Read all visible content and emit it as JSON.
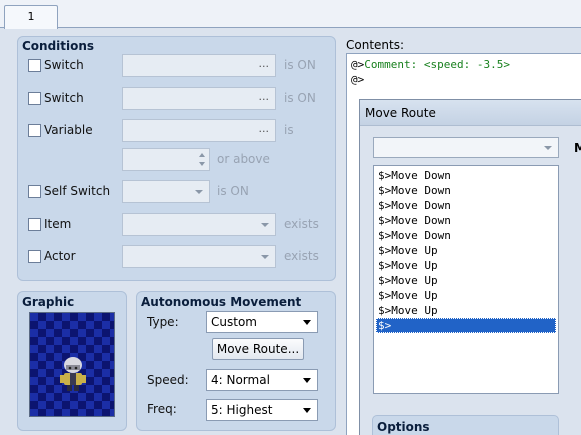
{
  "tab": {
    "label": "1"
  },
  "conditions": {
    "title": "Conditions",
    "rows": [
      {
        "label": "Switch",
        "suffix": "is ON"
      },
      {
        "label": "Switch",
        "suffix": "is ON"
      },
      {
        "label": "Variable",
        "suffix": "is"
      },
      {
        "label": "",
        "suffix": "or above"
      },
      {
        "label": "Self Switch",
        "suffix": "is ON"
      },
      {
        "label": "Item",
        "suffix": "exists"
      },
      {
        "label": "Actor",
        "suffix": "exists"
      }
    ],
    "browse_glyph": "..."
  },
  "graphic": {
    "title": "Graphic"
  },
  "autonomous": {
    "title": "Autonomous Movement",
    "type_label": "Type:",
    "type_value": "Custom",
    "move_route_button": "Move Route...",
    "speed_label": "Speed:",
    "speed_value": "4: Normal",
    "freq_label": "Freq:",
    "freq_value": "5: Highest"
  },
  "contents": {
    "label": "Contents:",
    "lines": [
      {
        "prefix": "@>",
        "text": "Comment: <speed: -3.5>"
      },
      {
        "prefix": "@>",
        "text": ""
      }
    ]
  },
  "move_route_dialog": {
    "title": "Move Route",
    "right_header_fragment": "M",
    "list": [
      "$>Move Down",
      "$>Move Down",
      "$>Move Down",
      "$>Move Down",
      "$>Move Down",
      "$>Move Up",
      "$>Move Up",
      "$>Move Up",
      "$>Move Up",
      "$>Move Up",
      "$>"
    ],
    "selected_index": 10,
    "options_title": "Options"
  }
}
